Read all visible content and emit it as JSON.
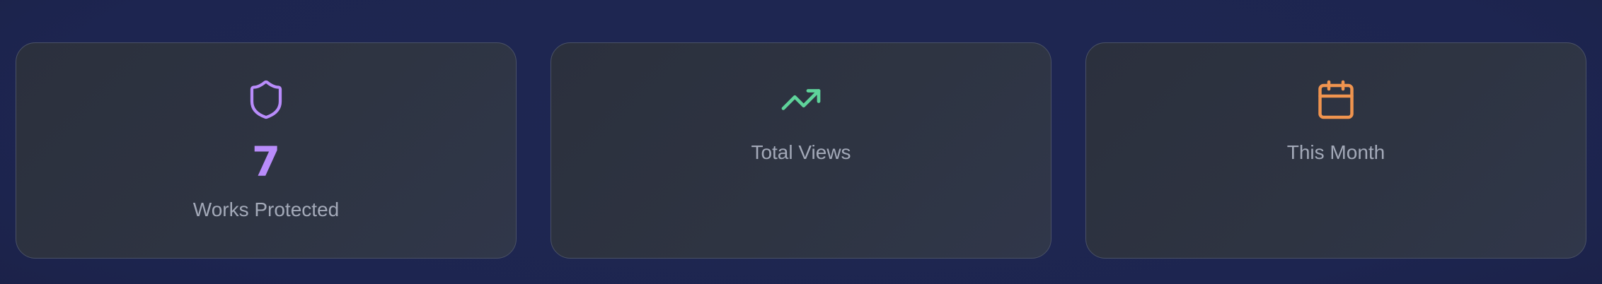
{
  "stats": [
    {
      "icon": "shield-icon",
      "icon_color": "#b98cfb",
      "value": "7",
      "value_color": "#b98cfb",
      "label": "Works Protected"
    },
    {
      "icon": "trending-up-icon",
      "icon_color": "#5ed39a",
      "label": "Total Views"
    },
    {
      "icon": "calendar-icon",
      "icon_color": "#f0944f",
      "label": "This Month"
    }
  ]
}
